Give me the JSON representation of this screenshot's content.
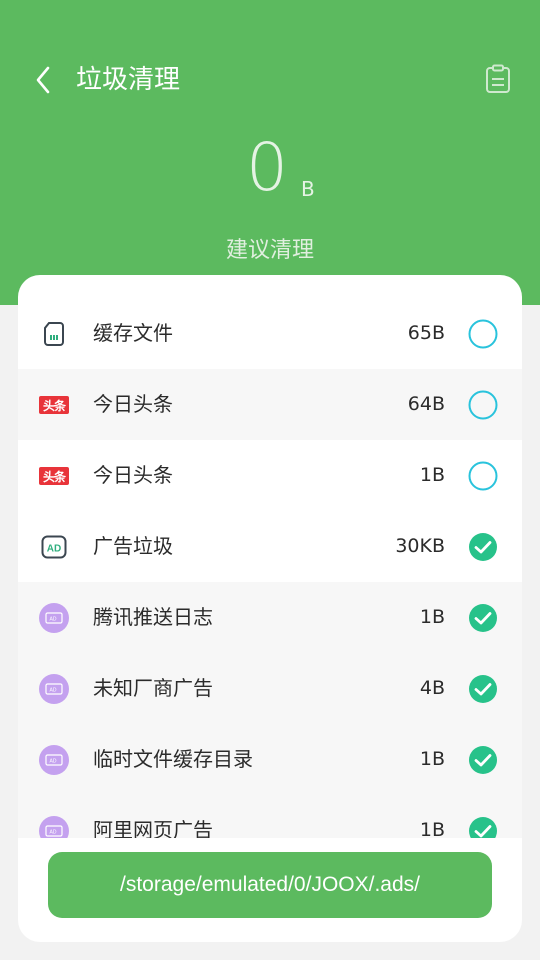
{
  "header": {
    "title": "垃圾清理",
    "size_value": "0",
    "size_unit": "B",
    "suggestion": "建议清理"
  },
  "items": [
    {
      "icon": "sd-card-icon",
      "label": "缓存文件",
      "size": "65B",
      "checked": false
    },
    {
      "icon": "toutiao-logo-icon",
      "label": "今日头条",
      "size": "64B",
      "checked": false,
      "logo_text": "头条"
    },
    {
      "icon": "toutiao-logo-icon",
      "label": "今日头条",
      "size": "1B",
      "checked": false,
      "logo_text": "头条"
    },
    {
      "icon": "ad-icon",
      "label": "广告垃圾",
      "size": "30KB",
      "checked": true,
      "icon_text": "AD"
    },
    {
      "icon": "ad-ticket-icon",
      "label": "腾讯推送日志",
      "size": "1B",
      "checked": true
    },
    {
      "icon": "ad-ticket-icon",
      "label": "未知厂商广告",
      "size": "4B",
      "checked": true
    },
    {
      "icon": "ad-ticket-icon",
      "label": "临时文件缓存目录",
      "size": "1B",
      "checked": true
    },
    {
      "icon": "ad-ticket-icon",
      "label": "阿里网页广告",
      "size": "1B",
      "checked": true
    }
  ],
  "path_button": {
    "label": "/storage/emulated/0/JOOX/.ads/"
  },
  "colors": {
    "brand_green": "#5cba5f",
    "check_green": "#27c28a",
    "unchecked_ring": "#29c3dc",
    "toutiao_red": "#e8343a",
    "ad_purple": "#c4a1ef"
  }
}
